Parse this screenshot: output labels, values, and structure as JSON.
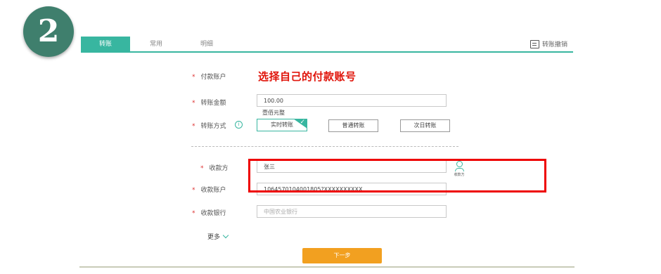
{
  "step_number": "2",
  "tabs": [
    {
      "label": "转账",
      "active": true
    },
    {
      "label": "常用",
      "active": false
    },
    {
      "label": "明细",
      "active": false
    }
  ],
  "undo_link": {
    "label": "转账撤销",
    "icon": "document-undo-icon"
  },
  "form": {
    "payer_account": {
      "label": "付款账户",
      "required": true
    },
    "amount": {
      "label": "转账金额",
      "value": "100.00",
      "hint": "壹佰元整",
      "required": true
    },
    "method": {
      "label": "转账方式",
      "required": true,
      "info_icon": "info-icon",
      "options": [
        "实时转账",
        "普通转账",
        "次日转账"
      ],
      "selected": "实时转账"
    },
    "payee": {
      "label": "收款方",
      "value": "张三",
      "required": true,
      "contact_label": "收款方"
    },
    "payee_account": {
      "label": "收款账户",
      "value": "1064570104001805?XXXXXXXXXX",
      "required": true
    },
    "payee_bank": {
      "label": "收款银行",
      "placeholder": "中国农业银行",
      "required": true
    },
    "more_label": "更多"
  },
  "annotation": "选择自己的付款账号",
  "next_button": "下一步",
  "colors": {
    "accent": "#38b6a0",
    "highlight": "#e00000",
    "button": "#f2a020",
    "badge": "#3f7f6d"
  }
}
